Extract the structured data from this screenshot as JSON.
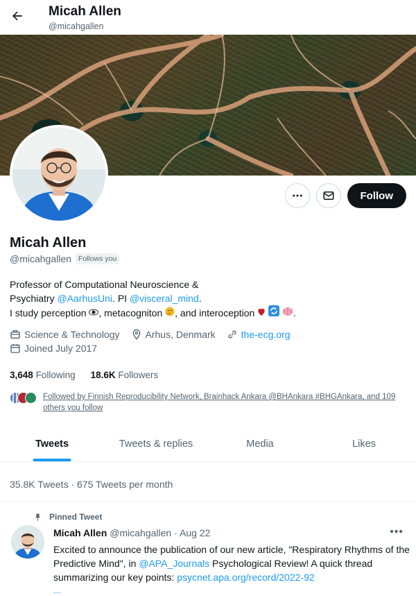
{
  "header": {
    "name": "Micah Allen",
    "handle": "@micahgallen"
  },
  "profile": {
    "name": "Micah Allen",
    "handle": "@micahgallen",
    "follows_you": "Follows you",
    "follow_label": "Follow",
    "bio": {
      "line1": "Professor of Computational Neuroscience &",
      "line2_a": "Psychiatry ",
      "line2_link1": "@AarhusUni",
      "line2_b": ". PI ",
      "line2_link2": "@visceral_mind",
      "line2_c": ".",
      "line3_a": "I study perception ",
      "line3_b": ", metacogniton ",
      "line3_c": ", and interoception ",
      "line3_d": "."
    },
    "category": "Science & Technology",
    "location": "Arhus, Denmark",
    "website": "the-ecg.org",
    "joined": "Joined July 2017",
    "following_count": "3,648",
    "following_label": "Following",
    "followers_count": "18.6K",
    "followers_label": "Followers",
    "followed_by": "Followed by Finnish Reproducibility Network, Brainhack Ankara @BHAnkara #BHGAnkara, and 109 others you follow"
  },
  "tabs": [
    {
      "label": "Tweets",
      "active": true
    },
    {
      "label": "Tweets & replies",
      "active": false
    },
    {
      "label": "Media",
      "active": false
    },
    {
      "label": "Likes",
      "active": false
    }
  ],
  "stats": {
    "tweet_summary": "35.8K Tweets · 675 Tweets per month"
  },
  "pinned_tweet": {
    "pinned_label": "Pinned Tweet",
    "author": "Micah Allen",
    "handle": "@micahgallen",
    "date": "· Aug 22",
    "text_a": "Excited to announce the publication of our new article, \"Respiratory Rhythms of the Predictive Mind\", in ",
    "mention": "@APA_Journals",
    "text_b": " Psychological Review! A quick thread summarizing our key points: ",
    "link": "psycnet.apa.org/record/2022-92",
    "ellipsis": "..."
  },
  "colors": {
    "accent": "#1d9bf0",
    "text": "#0f1419",
    "muted": "#536471",
    "follow_bg": "#0f1419"
  }
}
